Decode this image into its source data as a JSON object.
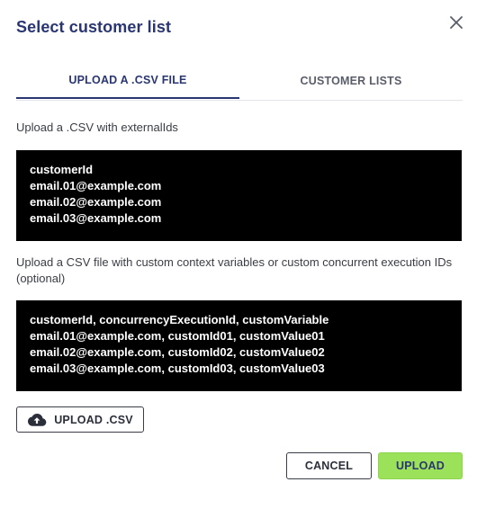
{
  "dialog": {
    "title": "Select customer list"
  },
  "tabs": [
    {
      "label": "UPLOAD A .CSV FILE",
      "active": true
    },
    {
      "label": "CUSTOMER LISTS",
      "active": false
    }
  ],
  "upload_section": {
    "externalids_label": "Upload a .CSV with externalIds",
    "externalids_example": [
      "customerId",
      "email.01@example.com",
      "email.02@example.com",
      "email.03@example.com"
    ],
    "context_label": "Upload a CSV file with custom context variables or custom concurrent execution IDs (optional)",
    "context_example": [
      "customerId, concurrencyExecutionId, customVariable",
      "email.01@example.com, customId01, customValue01",
      "email.02@example.com, customId02, customValue02",
      "email.03@example.com, customId03, customValue03"
    ],
    "upload_csv_label": "UPLOAD .CSV"
  },
  "footer": {
    "cancel_label": "CANCEL",
    "upload_label": "UPLOAD"
  },
  "icons": {
    "close": "close-icon",
    "upload": "cloud-upload-icon"
  },
  "colors": {
    "title": "#2a3672",
    "primary_button": "#9be25a",
    "code_background": "#000000"
  }
}
